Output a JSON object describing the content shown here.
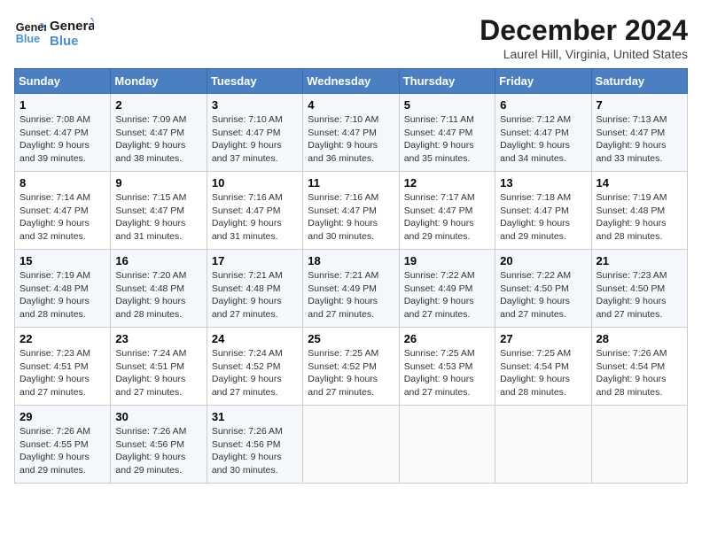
{
  "header": {
    "logo_line1": "General",
    "logo_line2": "Blue",
    "month_title": "December 2024",
    "location": "Laurel Hill, Virginia, United States"
  },
  "days_of_week": [
    "Sunday",
    "Monday",
    "Tuesday",
    "Wednesday",
    "Thursday",
    "Friday",
    "Saturday"
  ],
  "weeks": [
    [
      {
        "day": "1",
        "info": "Sunrise: 7:08 AM\nSunset: 4:47 PM\nDaylight: 9 hours\nand 39 minutes."
      },
      {
        "day": "2",
        "info": "Sunrise: 7:09 AM\nSunset: 4:47 PM\nDaylight: 9 hours\nand 38 minutes."
      },
      {
        "day": "3",
        "info": "Sunrise: 7:10 AM\nSunset: 4:47 PM\nDaylight: 9 hours\nand 37 minutes."
      },
      {
        "day": "4",
        "info": "Sunrise: 7:10 AM\nSunset: 4:47 PM\nDaylight: 9 hours\nand 36 minutes."
      },
      {
        "day": "5",
        "info": "Sunrise: 7:11 AM\nSunset: 4:47 PM\nDaylight: 9 hours\nand 35 minutes."
      },
      {
        "day": "6",
        "info": "Sunrise: 7:12 AM\nSunset: 4:47 PM\nDaylight: 9 hours\nand 34 minutes."
      },
      {
        "day": "7",
        "info": "Sunrise: 7:13 AM\nSunset: 4:47 PM\nDaylight: 9 hours\nand 33 minutes."
      }
    ],
    [
      {
        "day": "8",
        "info": "Sunrise: 7:14 AM\nSunset: 4:47 PM\nDaylight: 9 hours\nand 32 minutes."
      },
      {
        "day": "9",
        "info": "Sunrise: 7:15 AM\nSunset: 4:47 PM\nDaylight: 9 hours\nand 31 minutes."
      },
      {
        "day": "10",
        "info": "Sunrise: 7:16 AM\nSunset: 4:47 PM\nDaylight: 9 hours\nand 31 minutes."
      },
      {
        "day": "11",
        "info": "Sunrise: 7:16 AM\nSunset: 4:47 PM\nDaylight: 9 hours\nand 30 minutes."
      },
      {
        "day": "12",
        "info": "Sunrise: 7:17 AM\nSunset: 4:47 PM\nDaylight: 9 hours\nand 29 minutes."
      },
      {
        "day": "13",
        "info": "Sunrise: 7:18 AM\nSunset: 4:47 PM\nDaylight: 9 hours\nand 29 minutes."
      },
      {
        "day": "14",
        "info": "Sunrise: 7:19 AM\nSunset: 4:48 PM\nDaylight: 9 hours\nand 28 minutes."
      }
    ],
    [
      {
        "day": "15",
        "info": "Sunrise: 7:19 AM\nSunset: 4:48 PM\nDaylight: 9 hours\nand 28 minutes."
      },
      {
        "day": "16",
        "info": "Sunrise: 7:20 AM\nSunset: 4:48 PM\nDaylight: 9 hours\nand 28 minutes."
      },
      {
        "day": "17",
        "info": "Sunrise: 7:21 AM\nSunset: 4:48 PM\nDaylight: 9 hours\nand 27 minutes."
      },
      {
        "day": "18",
        "info": "Sunrise: 7:21 AM\nSunset: 4:49 PM\nDaylight: 9 hours\nand 27 minutes."
      },
      {
        "day": "19",
        "info": "Sunrise: 7:22 AM\nSunset: 4:49 PM\nDaylight: 9 hours\nand 27 minutes."
      },
      {
        "day": "20",
        "info": "Sunrise: 7:22 AM\nSunset: 4:50 PM\nDaylight: 9 hours\nand 27 minutes."
      },
      {
        "day": "21",
        "info": "Sunrise: 7:23 AM\nSunset: 4:50 PM\nDaylight: 9 hours\nand 27 minutes."
      }
    ],
    [
      {
        "day": "22",
        "info": "Sunrise: 7:23 AM\nSunset: 4:51 PM\nDaylight: 9 hours\nand 27 minutes."
      },
      {
        "day": "23",
        "info": "Sunrise: 7:24 AM\nSunset: 4:51 PM\nDaylight: 9 hours\nand 27 minutes."
      },
      {
        "day": "24",
        "info": "Sunrise: 7:24 AM\nSunset: 4:52 PM\nDaylight: 9 hours\nand 27 minutes."
      },
      {
        "day": "25",
        "info": "Sunrise: 7:25 AM\nSunset: 4:52 PM\nDaylight: 9 hours\nand 27 minutes."
      },
      {
        "day": "26",
        "info": "Sunrise: 7:25 AM\nSunset: 4:53 PM\nDaylight: 9 hours\nand 27 minutes."
      },
      {
        "day": "27",
        "info": "Sunrise: 7:25 AM\nSunset: 4:54 PM\nDaylight: 9 hours\nand 28 minutes."
      },
      {
        "day": "28",
        "info": "Sunrise: 7:26 AM\nSunset: 4:54 PM\nDaylight: 9 hours\nand 28 minutes."
      }
    ],
    [
      {
        "day": "29",
        "info": "Sunrise: 7:26 AM\nSunset: 4:55 PM\nDaylight: 9 hours\nand 29 minutes."
      },
      {
        "day": "30",
        "info": "Sunrise: 7:26 AM\nSunset: 4:56 PM\nDaylight: 9 hours\nand 29 minutes."
      },
      {
        "day": "31",
        "info": "Sunrise: 7:26 AM\nSunset: 4:56 PM\nDaylight: 9 hours\nand 30 minutes."
      },
      {
        "day": "",
        "info": ""
      },
      {
        "day": "",
        "info": ""
      },
      {
        "day": "",
        "info": ""
      },
      {
        "day": "",
        "info": ""
      }
    ]
  ]
}
